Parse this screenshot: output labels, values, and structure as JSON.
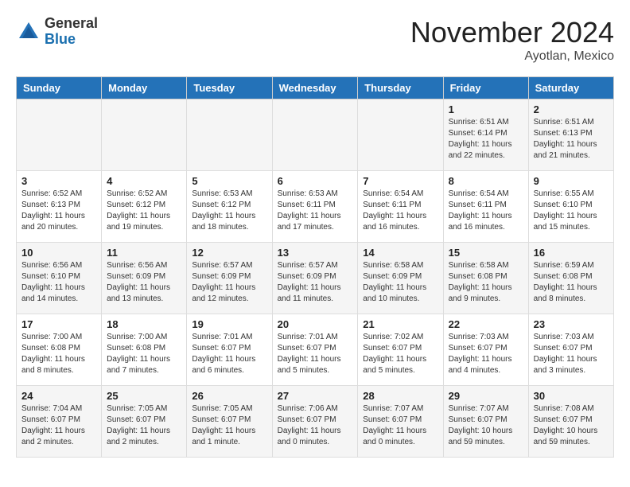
{
  "header": {
    "logo": {
      "general": "General",
      "blue": "Blue"
    },
    "title": "November 2024",
    "location": "Ayotlan, Mexico"
  },
  "weekdays": [
    "Sunday",
    "Monday",
    "Tuesday",
    "Wednesday",
    "Thursday",
    "Friday",
    "Saturday"
  ],
  "weeks": [
    [
      {
        "day": "",
        "info": ""
      },
      {
        "day": "",
        "info": ""
      },
      {
        "day": "",
        "info": ""
      },
      {
        "day": "",
        "info": ""
      },
      {
        "day": "",
        "info": ""
      },
      {
        "day": "1",
        "info": "Sunrise: 6:51 AM\nSunset: 6:14 PM\nDaylight: 11 hours\nand 22 minutes."
      },
      {
        "day": "2",
        "info": "Sunrise: 6:51 AM\nSunset: 6:13 PM\nDaylight: 11 hours\nand 21 minutes."
      }
    ],
    [
      {
        "day": "3",
        "info": "Sunrise: 6:52 AM\nSunset: 6:13 PM\nDaylight: 11 hours\nand 20 minutes."
      },
      {
        "day": "4",
        "info": "Sunrise: 6:52 AM\nSunset: 6:12 PM\nDaylight: 11 hours\nand 19 minutes."
      },
      {
        "day": "5",
        "info": "Sunrise: 6:53 AM\nSunset: 6:12 PM\nDaylight: 11 hours\nand 18 minutes."
      },
      {
        "day": "6",
        "info": "Sunrise: 6:53 AM\nSunset: 6:11 PM\nDaylight: 11 hours\nand 17 minutes."
      },
      {
        "day": "7",
        "info": "Sunrise: 6:54 AM\nSunset: 6:11 PM\nDaylight: 11 hours\nand 16 minutes."
      },
      {
        "day": "8",
        "info": "Sunrise: 6:54 AM\nSunset: 6:11 PM\nDaylight: 11 hours\nand 16 minutes."
      },
      {
        "day": "9",
        "info": "Sunrise: 6:55 AM\nSunset: 6:10 PM\nDaylight: 11 hours\nand 15 minutes."
      }
    ],
    [
      {
        "day": "10",
        "info": "Sunrise: 6:56 AM\nSunset: 6:10 PM\nDaylight: 11 hours\nand 14 minutes."
      },
      {
        "day": "11",
        "info": "Sunrise: 6:56 AM\nSunset: 6:09 PM\nDaylight: 11 hours\nand 13 minutes."
      },
      {
        "day": "12",
        "info": "Sunrise: 6:57 AM\nSunset: 6:09 PM\nDaylight: 11 hours\nand 12 minutes."
      },
      {
        "day": "13",
        "info": "Sunrise: 6:57 AM\nSunset: 6:09 PM\nDaylight: 11 hours\nand 11 minutes."
      },
      {
        "day": "14",
        "info": "Sunrise: 6:58 AM\nSunset: 6:09 PM\nDaylight: 11 hours\nand 10 minutes."
      },
      {
        "day": "15",
        "info": "Sunrise: 6:58 AM\nSunset: 6:08 PM\nDaylight: 11 hours\nand 9 minutes."
      },
      {
        "day": "16",
        "info": "Sunrise: 6:59 AM\nSunset: 6:08 PM\nDaylight: 11 hours\nand 8 minutes."
      }
    ],
    [
      {
        "day": "17",
        "info": "Sunrise: 7:00 AM\nSunset: 6:08 PM\nDaylight: 11 hours\nand 8 minutes."
      },
      {
        "day": "18",
        "info": "Sunrise: 7:00 AM\nSunset: 6:08 PM\nDaylight: 11 hours\nand 7 minutes."
      },
      {
        "day": "19",
        "info": "Sunrise: 7:01 AM\nSunset: 6:07 PM\nDaylight: 11 hours\nand 6 minutes."
      },
      {
        "day": "20",
        "info": "Sunrise: 7:01 AM\nSunset: 6:07 PM\nDaylight: 11 hours\nand 5 minutes."
      },
      {
        "day": "21",
        "info": "Sunrise: 7:02 AM\nSunset: 6:07 PM\nDaylight: 11 hours\nand 5 minutes."
      },
      {
        "day": "22",
        "info": "Sunrise: 7:03 AM\nSunset: 6:07 PM\nDaylight: 11 hours\nand 4 minutes."
      },
      {
        "day": "23",
        "info": "Sunrise: 7:03 AM\nSunset: 6:07 PM\nDaylight: 11 hours\nand 3 minutes."
      }
    ],
    [
      {
        "day": "24",
        "info": "Sunrise: 7:04 AM\nSunset: 6:07 PM\nDaylight: 11 hours\nand 2 minutes."
      },
      {
        "day": "25",
        "info": "Sunrise: 7:05 AM\nSunset: 6:07 PM\nDaylight: 11 hours\nand 2 minutes."
      },
      {
        "day": "26",
        "info": "Sunrise: 7:05 AM\nSunset: 6:07 PM\nDaylight: 11 hours\nand 1 minute."
      },
      {
        "day": "27",
        "info": "Sunrise: 7:06 AM\nSunset: 6:07 PM\nDaylight: 11 hours\nand 0 minutes."
      },
      {
        "day": "28",
        "info": "Sunrise: 7:07 AM\nSunset: 6:07 PM\nDaylight: 11 hours\nand 0 minutes."
      },
      {
        "day": "29",
        "info": "Sunrise: 7:07 AM\nSunset: 6:07 PM\nDaylight: 10 hours\nand 59 minutes."
      },
      {
        "day": "30",
        "info": "Sunrise: 7:08 AM\nSunset: 6:07 PM\nDaylight: 10 hours\nand 59 minutes."
      }
    ]
  ]
}
